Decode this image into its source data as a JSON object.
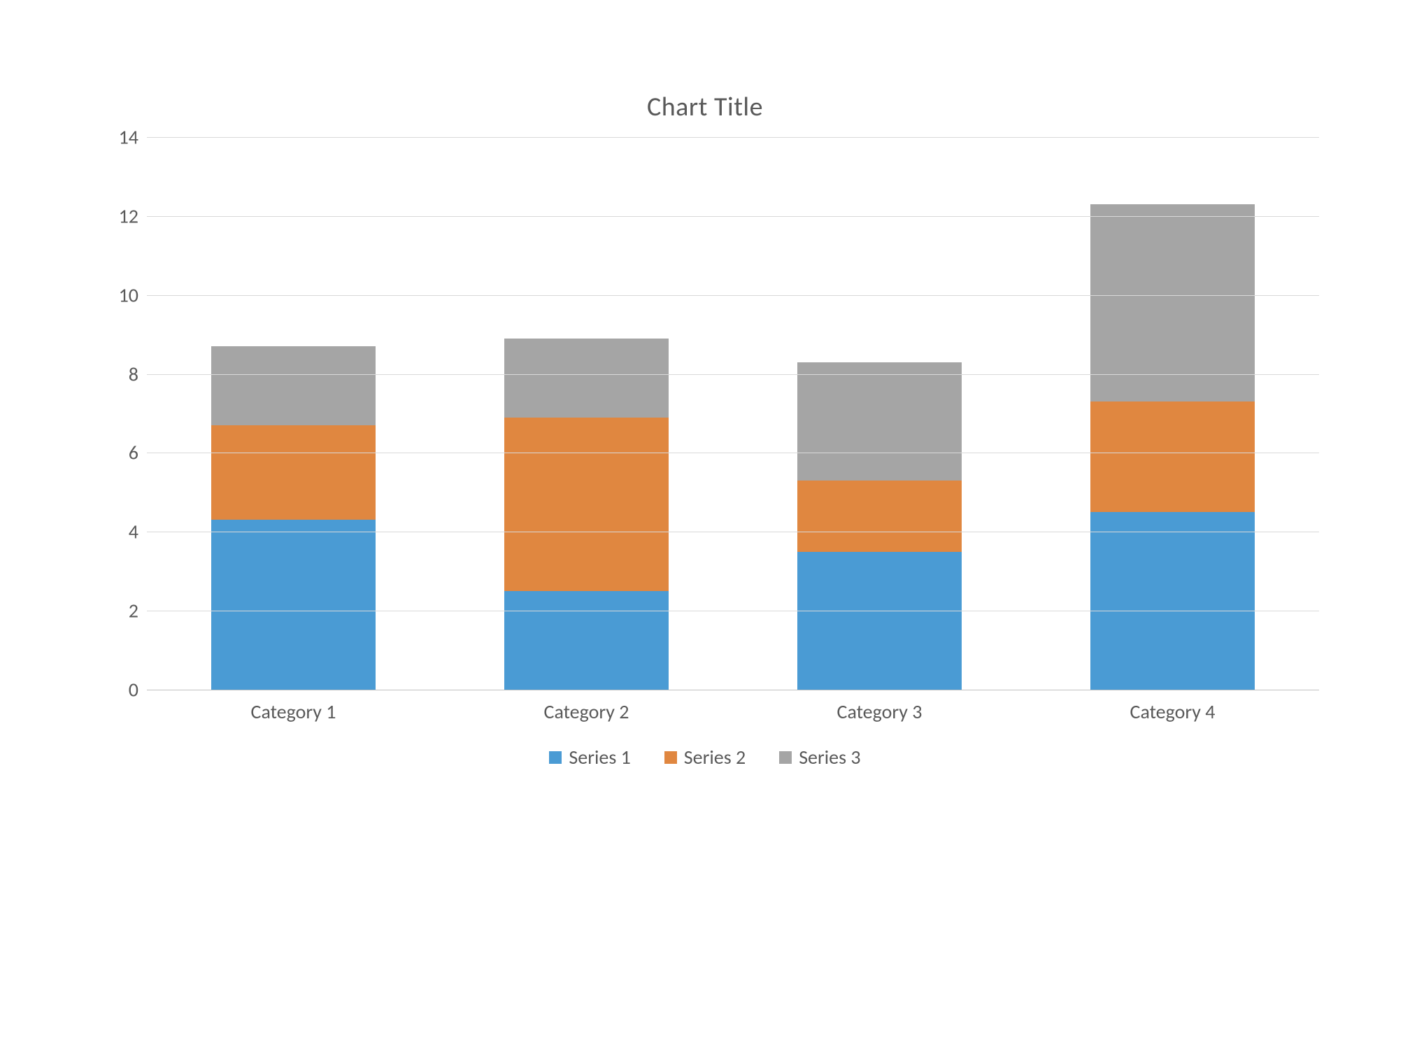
{
  "chart_data": {
    "type": "bar",
    "stacked": true,
    "title": "Chart Title",
    "xlabel": "",
    "ylabel": "",
    "ylim": [
      0,
      14
    ],
    "ystep": 2,
    "categories": [
      "Category 1",
      "Category 2",
      "Category 3",
      "Category 4"
    ],
    "series": [
      {
        "name": "Series 1",
        "color": "#4a9bd4",
        "values": [
          4.3,
          2.5,
          3.5,
          4.5
        ]
      },
      {
        "name": "Series 2",
        "color": "#e08740",
        "values": [
          2.4,
          4.4,
          1.8,
          2.8
        ]
      },
      {
        "name": "Series 3",
        "color": "#a5a5a5",
        "values": [
          2.0,
          2.0,
          3.0,
          5.0
        ]
      }
    ],
    "legend_position": "bottom",
    "grid": true
  }
}
